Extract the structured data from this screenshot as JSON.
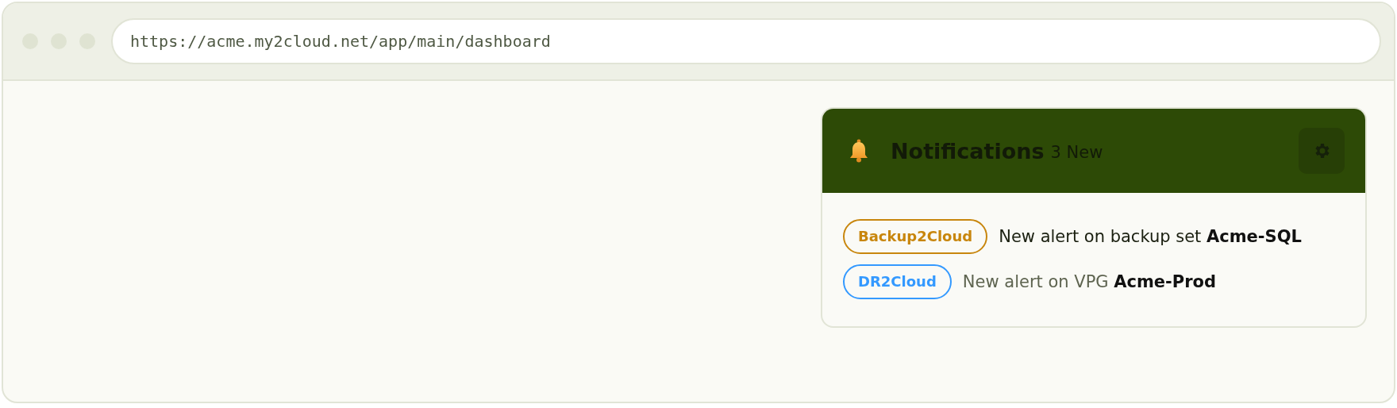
{
  "browser": {
    "url": "https://acme.my2cloud.net/app/main/dashboard"
  },
  "notifications": {
    "title": "Notifications",
    "count": "3 New",
    "items": [
      {
        "source": "Backup2Cloud",
        "color": "#c8860d",
        "message": "New alert on backup set **Acme-SQL**",
        "unread": true
      },
      {
        "source": "DR2Cloud",
        "color": "#3399ff",
        "message": "New alert on VPG **Acme-Prod**",
        "unread": false
      }
    ]
  }
}
